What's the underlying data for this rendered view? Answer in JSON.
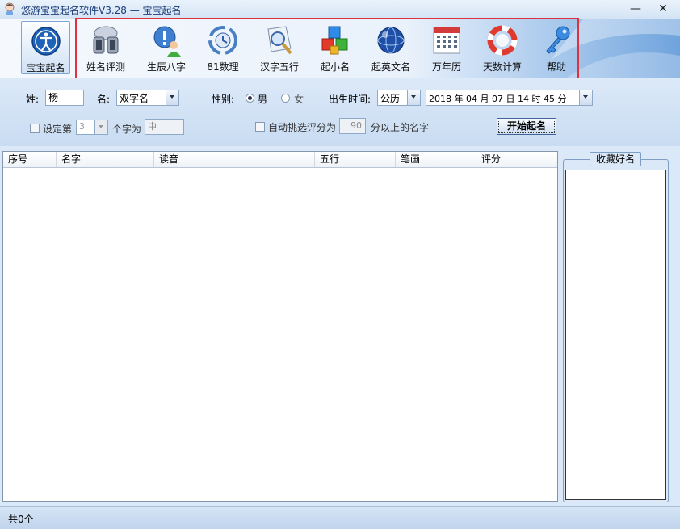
{
  "window": {
    "title": "悠游宝宝起名软件V3.28 — 宝宝起名",
    "minimize_glyph": "—",
    "close_glyph": "✕"
  },
  "toolbar": {
    "items": [
      {
        "label": "宝宝起名",
        "icon": "baby-naming-icon",
        "active": true
      },
      {
        "label": "姓名评测",
        "icon": "name-evaluation-icon"
      },
      {
        "label": "生辰八字",
        "icon": "birth-eight-characters-icon"
      },
      {
        "label": "81数理",
        "icon": "numerology-81-icon"
      },
      {
        "label": "汉字五行",
        "icon": "chinese-five-elements-icon"
      },
      {
        "label": "起小名",
        "icon": "nickname-icon"
      },
      {
        "label": "起英文名",
        "icon": "english-name-icon"
      },
      {
        "label": "万年历",
        "icon": "perpetual-calendar-icon"
      },
      {
        "label": "天数计算",
        "icon": "days-calculator-icon"
      },
      {
        "label": "帮助",
        "icon": "help-key-icon"
      }
    ],
    "highlight_color": "#e03140"
  },
  "form": {
    "surname_label": "姓:",
    "surname_value": "杨",
    "name_label": "名:",
    "name_type_value": "双字名",
    "gender_label": "性别:",
    "gender_male": "男",
    "gender_female": "女",
    "gender_selected": "男",
    "birth_label": "出生时间:",
    "calendar_value": "公历",
    "birth_datetime": "2018 年 04 月 07 日  14 时 45 分",
    "fix_char_label_pre": "设定第",
    "fix_char_pos": "3",
    "fix_char_label_post": "个字为",
    "fix_char_value": "中",
    "auto_pick_label": "自动挑选评分为",
    "auto_pick_score": "90",
    "auto_pick_suffix": "分以上的名字",
    "start_button": "开始起名"
  },
  "table": {
    "columns": [
      "序号",
      "名字",
      "读音",
      "五行",
      "笔画",
      "评分"
    ],
    "rows": []
  },
  "favorites": {
    "title": "收藏好名"
  },
  "status": {
    "text": "共0个"
  }
}
